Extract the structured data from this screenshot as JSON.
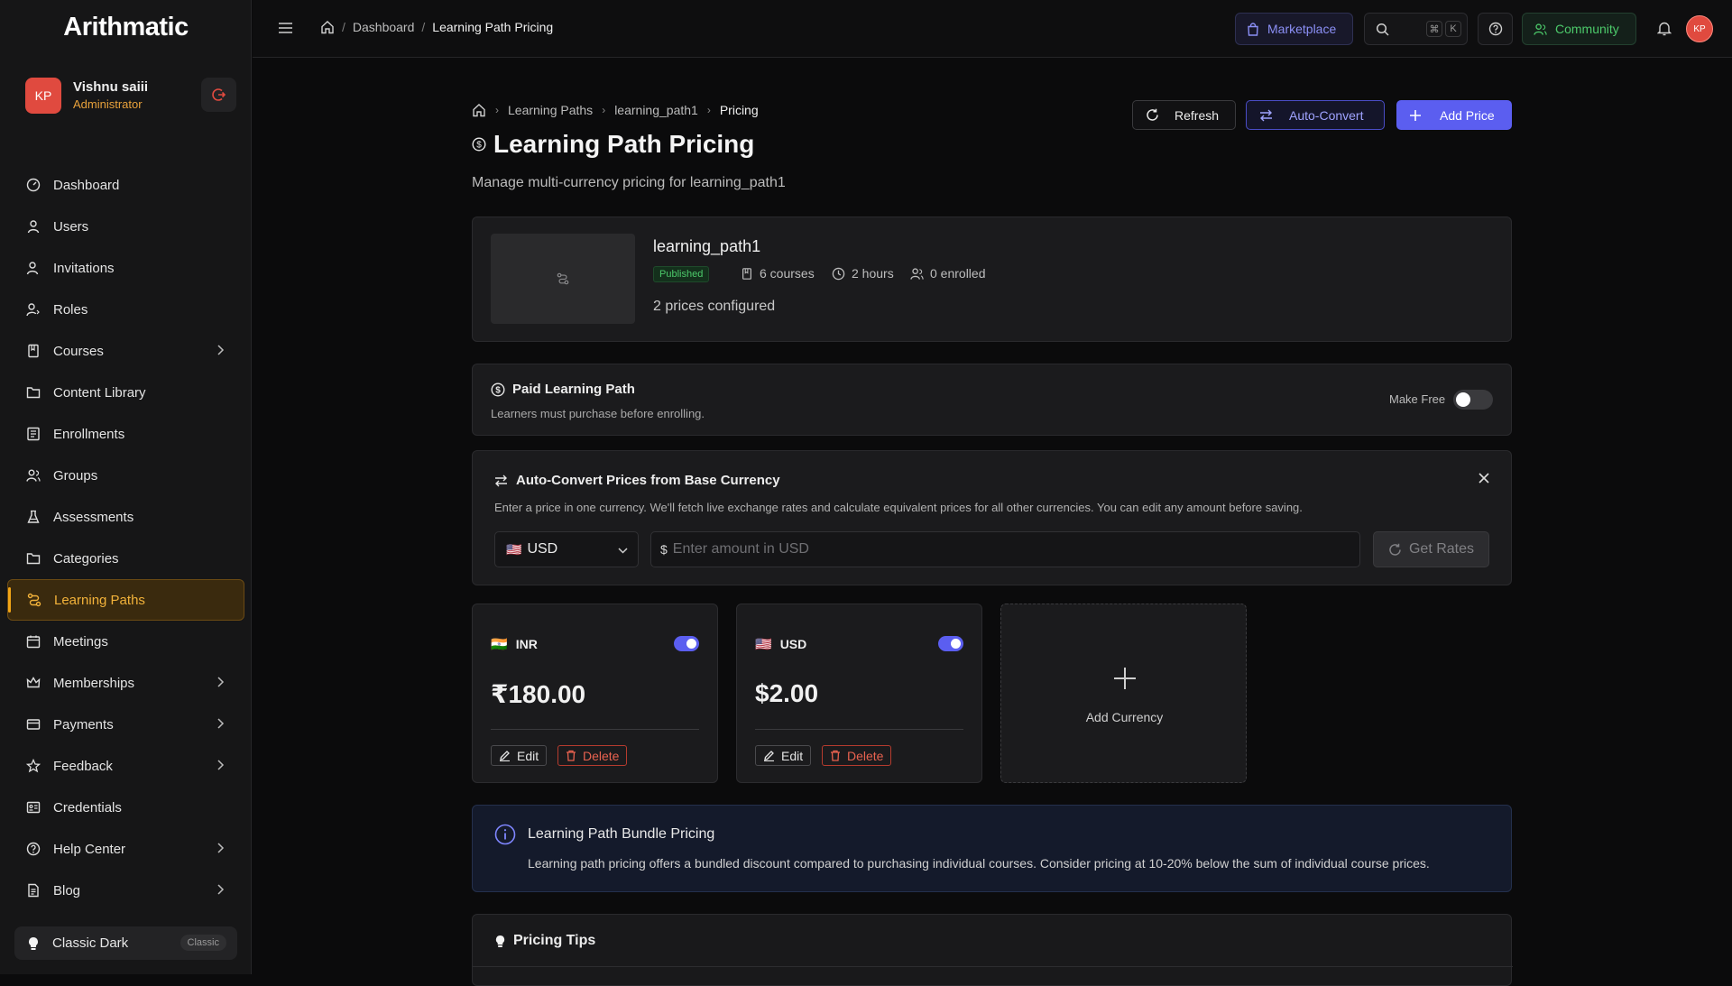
{
  "app": {
    "logo": "Arithmatic"
  },
  "user": {
    "initials": "KP",
    "name": "Vishnu saiii",
    "role": "Administrator"
  },
  "sidebar": {
    "items": [
      {
        "label": "Dashboard"
      },
      {
        "label": "Users"
      },
      {
        "label": "Invitations"
      },
      {
        "label": "Roles"
      },
      {
        "label": "Courses"
      },
      {
        "label": "Content Library"
      },
      {
        "label": "Enrollments"
      },
      {
        "label": "Groups"
      },
      {
        "label": "Assessments"
      },
      {
        "label": "Categories"
      },
      {
        "label": "Learning Paths"
      },
      {
        "label": "Meetings"
      },
      {
        "label": "Memberships"
      },
      {
        "label": "Payments"
      },
      {
        "label": "Feedback"
      },
      {
        "label": "Credentials"
      },
      {
        "label": "Help Center"
      },
      {
        "label": "Blog"
      }
    ],
    "theme": {
      "label": "Classic Dark",
      "badge": "Classic"
    }
  },
  "topbar": {
    "breadcrumb": [
      "Dashboard",
      "Learning Path Pricing"
    ],
    "marketplace": "Marketplace",
    "shortcut": [
      "⌘",
      "K"
    ],
    "community": "Community",
    "avatar": "KP"
  },
  "page": {
    "breadcrumb": [
      "Learning Paths",
      "learning_path1",
      "Pricing"
    ],
    "title": "Learning Path Pricing",
    "subtitle": "Manage multi-currency pricing for learning_path1",
    "buttons": {
      "refresh": "Refresh",
      "auto_convert": "Auto-Convert",
      "add_price": "Add Price"
    }
  },
  "learning_path": {
    "name": "learning_path1",
    "status": "Published",
    "courses": "6 courses",
    "duration": "2 hours",
    "enrolled": "0 enrolled",
    "prices_configured": "2 prices configured"
  },
  "paid": {
    "title": "Paid Learning Path",
    "description": "Learners must purchase before enrolling.",
    "toggle_label": "Make Free",
    "is_free": false
  },
  "auto_convert": {
    "title": "Auto-Convert Prices from Base Currency",
    "description": "Enter a price in one currency. We'll fetch live exchange rates and calculate equivalent prices for all other currencies. You can edit any amount before saving.",
    "currency": "USD",
    "currency_flag": "🇺🇸",
    "symbol": "$",
    "placeholder": "Enter amount in USD",
    "get_rates": "Get Rates"
  },
  "prices": [
    {
      "flag": "🇮🇳",
      "code": "INR",
      "amount": "₹180.00",
      "enabled": true,
      "edit": "Edit",
      "delete": "Delete"
    },
    {
      "flag": "🇺🇸",
      "code": "USD",
      "amount": "$2.00",
      "enabled": true,
      "edit": "Edit",
      "delete": "Delete"
    }
  ],
  "add_currency": "Add Currency",
  "bundle": {
    "title": "Learning Path Bundle Pricing",
    "description": "Learning path pricing offers a bundled discount compared to purchasing individual courses. Consider pricing at 10-20% below the sum of individual course prices."
  },
  "tips": {
    "title": "Pricing Tips"
  },
  "colors": {
    "accent": "#5b5ef0",
    "brand_active": "#f2b23a",
    "danger": "#e8624f",
    "success": "#4cc96a",
    "avatar": "#e04a3f"
  }
}
